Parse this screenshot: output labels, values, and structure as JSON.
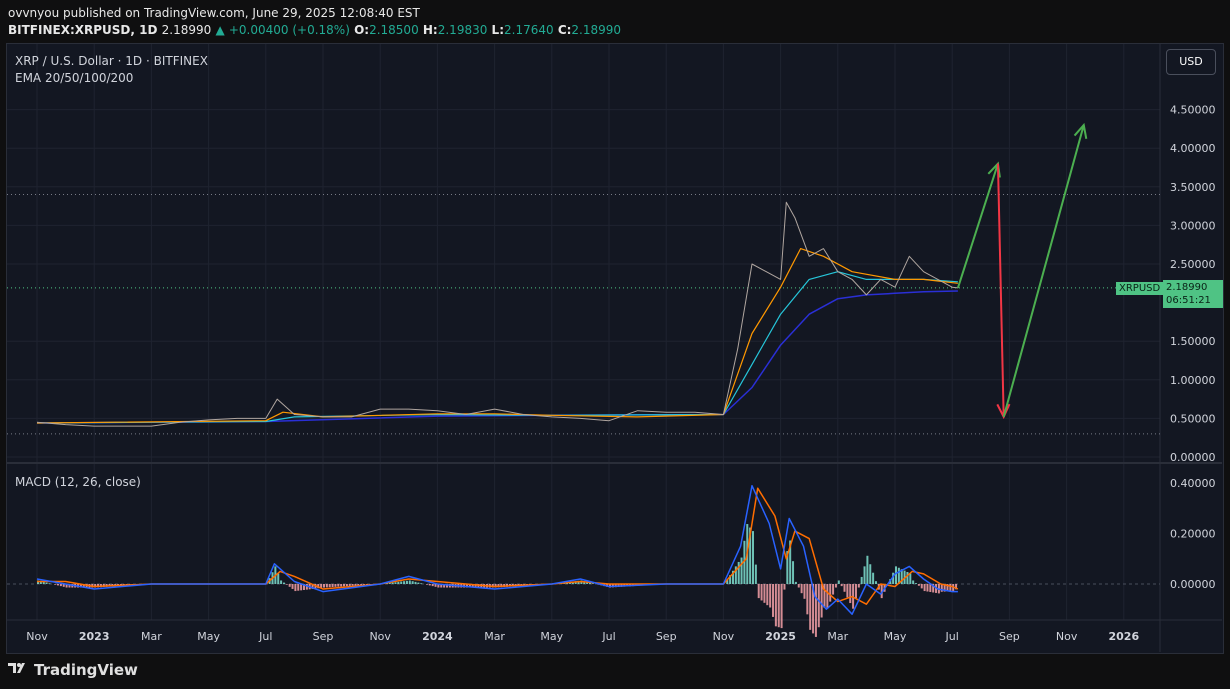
{
  "header": {
    "published": "ovvnyou published on TradingView.com, June 29, 2025 12:08:40 EST",
    "symbol": "BITFINEX:XRPUSD, 1D",
    "price": "2.18990",
    "change": "+0.00400 (+0.18%)",
    "o_label": "O:",
    "o": "2.18500",
    "h_label": "H:",
    "h": "2.19830",
    "l_label": "L:",
    "l": "2.17640",
    "c_label": "C:",
    "c": "2.18990"
  },
  "chart": {
    "title": "XRP / U.S. Dollar · 1D · BITFINEX",
    "indicator": "EMA 20/50/100/200",
    "currency_button": "USD",
    "ticker_tag": "XRPUSD",
    "price_tag": "2.18990",
    "countdown_tag": "06:51:21",
    "macd_title": "MACD (12, 26, close)"
  },
  "colors": {
    "up": "#22ab94",
    "down": "#f23645",
    "ema20": "#f23645",
    "ema50": "#ff9800",
    "ema100": "#26c6da",
    "ema200": "#2a2fd6",
    "macd": "#2962ff",
    "signal": "#ff6d00",
    "arrow_green": "#4caf50",
    "arrow_red": "#f23645"
  },
  "chart_data": {
    "type": "line",
    "price_axis_ticks": [
      "4.50000",
      "4.00000",
      "3.50000",
      "3.00000",
      "2.50000",
      "1.50000",
      "1.00000",
      "0.50000",
      "0.00000"
    ],
    "price_ylim": [
      0,
      5.2
    ],
    "macd_axis_ticks": [
      "0.40000",
      "0.20000",
      "0.00000"
    ],
    "macd_ylim": [
      -0.15,
      0.45
    ],
    "x_labels": [
      "Nov",
      "2023",
      "Mar",
      "May",
      "Jul",
      "Sep",
      "Nov",
      "2024",
      "Mar",
      "May",
      "Jul",
      "Sep",
      "Nov",
      "2025",
      "Mar",
      "May",
      "Jul",
      "Sep",
      "Nov",
      "2026"
    ],
    "x_label_months": [
      0,
      2,
      4,
      6,
      8,
      10,
      12,
      14,
      16,
      18,
      20,
      22,
      24,
      26,
      28,
      30,
      32,
      34,
      36,
      38
    ],
    "series": [
      {
        "key": "price",
        "x": [
          0,
          1,
          2,
          3,
          4,
          5,
          6,
          7,
          8,
          8.4,
          9,
          10,
          11,
          12,
          13,
          14,
          15,
          16,
          17,
          18,
          19,
          20,
          21,
          22,
          23,
          24,
          24.5,
          25,
          25.5,
          26,
          26.2,
          26.5,
          27,
          27.5,
          28,
          28.5,
          29,
          29.5,
          30,
          30.5,
          31,
          31.5,
          32,
          32.2
        ],
        "values": [
          0.45,
          0.42,
          0.4,
          0.4,
          0.4,
          0.45,
          0.48,
          0.5,
          0.5,
          0.75,
          0.55,
          0.52,
          0.52,
          0.62,
          0.62,
          0.6,
          0.55,
          0.62,
          0.55,
          0.52,
          0.5,
          0.47,
          0.6,
          0.58,
          0.58,
          0.55,
          1.4,
          2.5,
          2.4,
          2.3,
          3.3,
          3.1,
          2.6,
          2.7,
          2.4,
          2.3,
          2.1,
          2.3,
          2.2,
          2.6,
          2.4,
          2.3,
          2.2,
          2.19
        ]
      },
      {
        "key": "ema50",
        "x": [
          0,
          8,
          8.6,
          10,
          14,
          16,
          18,
          21,
          24,
          25,
          26,
          26.7,
          27.5,
          28.5,
          30,
          31,
          32.2
        ],
        "values": [
          0.44,
          0.47,
          0.58,
          0.52,
          0.56,
          0.56,
          0.54,
          0.52,
          0.55,
          1.6,
          2.2,
          2.7,
          2.6,
          2.4,
          2.3,
          2.3,
          2.25
        ]
      },
      {
        "key": "ema100",
        "x": [
          0,
          8,
          9,
          14,
          18,
          24,
          25,
          26,
          27,
          28,
          29,
          30,
          31,
          32.2
        ],
        "values": [
          0.44,
          0.46,
          0.52,
          0.55,
          0.54,
          0.55,
          1.2,
          1.85,
          2.3,
          2.4,
          2.3,
          2.3,
          2.3,
          2.27
        ]
      },
      {
        "key": "ema200",
        "x": [
          0,
          8,
          14,
          18,
          24,
          25,
          26,
          27,
          28,
          29,
          30,
          31,
          32.2
        ],
        "values": [
          0.44,
          0.46,
          0.53,
          0.54,
          0.55,
          0.9,
          1.45,
          1.85,
          2.05,
          2.1,
          2.12,
          2.14,
          2.15
        ]
      },
      {
        "key": "macd",
        "x": [
          0,
          1,
          2,
          4,
          6,
          8,
          8.3,
          9,
          10,
          12,
          13,
          14,
          16,
          18,
          19,
          20,
          22,
          24,
          24.6,
          25,
          25.6,
          26,
          26.3,
          26.8,
          27.2,
          27.6,
          28,
          28.5,
          29,
          29.5,
          30,
          30.5,
          31,
          31.5,
          32,
          32.2
        ],
        "values": [
          0.02,
          0.0,
          -0.02,
          0.0,
          0.0,
          0.0,
          0.08,
          0.01,
          -0.03,
          0.0,
          0.03,
          0.0,
          -0.02,
          0.0,
          0.02,
          -0.01,
          0.0,
          0.0,
          0.15,
          0.39,
          0.24,
          0.06,
          0.26,
          0.15,
          -0.05,
          -0.1,
          -0.06,
          -0.12,
          0.0,
          -0.04,
          0.04,
          0.07,
          0.02,
          -0.02,
          -0.03,
          -0.03
        ]
      },
      {
        "key": "signal",
        "x": [
          0,
          1,
          2,
          4,
          6,
          8,
          8.5,
          9,
          10,
          12,
          13,
          14,
          16,
          18,
          19,
          20,
          22,
          24,
          24.8,
          25.2,
          25.8,
          26.2,
          26.5,
          27,
          27.5,
          28,
          28.5,
          29,
          29.5,
          30,
          30.6,
          31,
          31.6,
          32,
          32.2
        ],
        "values": [
          0.01,
          0.01,
          -0.01,
          0.0,
          0.0,
          0.0,
          0.05,
          0.03,
          -0.02,
          0.0,
          0.02,
          0.01,
          -0.01,
          0.0,
          0.01,
          0.0,
          0.0,
          0.0,
          0.1,
          0.38,
          0.27,
          0.1,
          0.21,
          0.18,
          -0.02,
          -0.07,
          -0.05,
          -0.08,
          0.0,
          -0.01,
          0.05,
          0.04,
          0.0,
          -0.01,
          -0.02
        ]
      }
    ],
    "annotations": [
      {
        "type": "arrow",
        "color": "green",
        "from": [
          32.2,
          2.19
        ],
        "to": [
          33.6,
          3.8
        ]
      },
      {
        "type": "arrow",
        "color": "red",
        "from": [
          33.6,
          3.8
        ],
        "to": [
          33.8,
          0.52
        ]
      },
      {
        "type": "arrow",
        "color": "green",
        "from": [
          33.8,
          0.52
        ],
        "to": [
          36.6,
          4.3
        ]
      }
    ],
    "horizontal_lines": [
      3.4,
      2.19,
      0.3
    ]
  }
}
